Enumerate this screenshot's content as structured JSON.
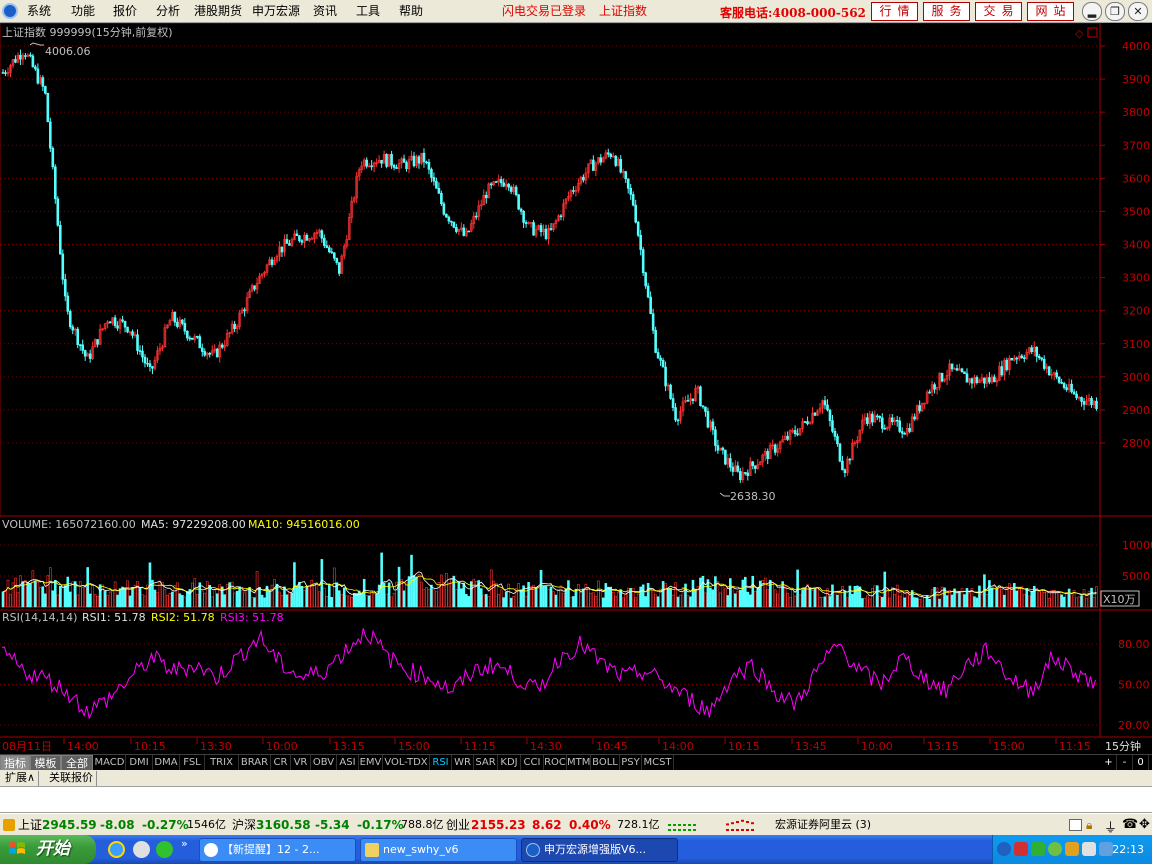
{
  "menubar": {
    "items": [
      "系统",
      "功能",
      "报价",
      "分析",
      "港股期货",
      "申万宏源",
      "资讯",
      "工具",
      "帮助"
    ],
    "flash_login": "闪电交易已登录",
    "current_index": "上证指数",
    "hotline": "客服电话:4008-000-562",
    "quick_buttons": [
      "行情",
      "服务",
      "交易",
      "网站"
    ]
  },
  "price_pane": {
    "title": "上证指数 999999(15分钟,前复权)",
    "high_label": "4006.06",
    "low_label": "2638.30",
    "y_ticks": [
      "4000",
      "3900",
      "3800",
      "3700",
      "3600",
      "3500",
      "3400",
      "3300",
      "3200",
      "3100",
      "3000",
      "2900",
      "2800"
    ]
  },
  "volume_pane": {
    "label": "VOLUME: 165072160.00",
    "ma5": "MA5: 97229208.00",
    "ma10": "MA10: 94516016.00",
    "y_ticks": [
      "10000",
      "5000"
    ],
    "unit": "X10万"
  },
  "rsi_pane": {
    "label": "RSI(14,14,14)",
    "rsi1": "RSI1: 51.78",
    "rsi2": "RSI2: 51.78",
    "rsi3": "RSI3: 51.78",
    "y_ticks": [
      "80.00",
      "50.00",
      "20.00"
    ]
  },
  "time_axis": {
    "labels": [
      "08月11日",
      "14:00",
      "10:15",
      "13:30",
      "10:00",
      "13:15",
      "15:00",
      "11:15",
      "14:30",
      "10:45",
      "14:00",
      "10:15",
      "13:45",
      "10:00",
      "13:15",
      "15:00",
      "11:15"
    ],
    "period": "15分钟"
  },
  "indicator_tabs": {
    "categories": [
      "指标",
      "模板",
      "全部"
    ],
    "items": [
      "MACD",
      "DMI",
      "DMA",
      "FSL",
      "TRIX",
      "BRAR",
      "CR",
      "VR",
      "OBV",
      "ASI",
      "EMV",
      "VOL-TDX",
      "RSI",
      "WR",
      "SAR",
      "KDJ",
      "CCI",
      "ROC",
      "MTM",
      "BOLL",
      "PSY",
      "MCST"
    ],
    "active": "RSI",
    "controls": [
      "+",
      "-",
      "0"
    ]
  },
  "ext_tabs": [
    "扩展∧",
    "关联报价"
  ],
  "ticker": {
    "sh_name": "上证",
    "sh_price": "2945.59",
    "sh_change": "-8.08",
    "sh_pct": "-0.27%",
    "sh_amount": "1546亿",
    "hs_name": "沪深",
    "hs_price": "3160.58",
    "hs_change": "-5.34",
    "hs_pct": "-0.17%",
    "hs_amount": "788.8亿",
    "cy_name": "创业",
    "cy_price": "2155.23",
    "cy_change": "8.62",
    "cy_pct": "0.40%",
    "cy_amount": "728.1亿",
    "broker": "宏源证券阿里云 (3)"
  },
  "taskbar": {
    "start_label": "开始",
    "tasks": [
      "【新提醒】12 - 2...",
      "new_swhy_v6",
      "申万宏源增强版V6..."
    ],
    "clock": "22:13"
  },
  "chart_data": [
    {
      "type": "line",
      "title": "上证指数 999999(15分钟,前复权)",
      "description": "candlestick (OHLC) price series, 15-minute bars",
      "ylim": [
        2600,
        4050
      ],
      "annotations": [
        {
          "label": "4006.06",
          "kind": "high"
        },
        {
          "label": "2638.30",
          "kind": "low"
        }
      ],
      "x": [
        0,
        25,
        50,
        75,
        100,
        125,
        150,
        175,
        200,
        225,
        250,
        275,
        300,
        325,
        350,
        375,
        400,
        425,
        450,
        475,
        500,
        525,
        550,
        575,
        600,
        625,
        650,
        675,
        700,
        725,
        750,
        775,
        800,
        825,
        850,
        875,
        900,
        925,
        950,
        975,
        1000,
        1025,
        1050,
        1075,
        1100
      ],
      "values": [
        3920,
        3990,
        3860,
        3200,
        3050,
        3180,
        3150,
        3010,
        3180,
        3120,
        3060,
        3150,
        3280,
        3380,
        3420,
        3440,
        3320,
        3650,
        3660,
        3640,
        3660,
        3500,
        3420,
        3560,
        3600,
        3450,
        3430,
        3560,
        3640,
        3680,
        3520,
        3100,
        2880,
        2960,
        2780,
        2700,
        2750,
        2800,
        2850,
        2930,
        2720,
        2880,
        2860,
        2840,
        2960,
        3020,
        2990,
        2990,
        3060,
        3080,
        3000,
        2940,
        2920
      ],
      "series_note": "approximate close levels read off the price axis"
    },
    {
      "type": "bar",
      "title": "VOLUME",
      "unit": "X10万",
      "ylim": [
        0,
        12000
      ],
      "values": [
        3800,
        4200,
        3600,
        3200,
        3000,
        3400,
        3100,
        2900,
        3300,
        3000,
        2800,
        3200,
        3500,
        3100,
        2900,
        3400,
        3200,
        4200,
        4000,
        3300,
        3100,
        2800,
        2900,
        3100,
        3000,
        2800,
        2700,
        3000,
        3200,
        3600,
        3400,
        3800,
        3200,
        2800,
        2600,
        2700,
        2500,
        2600,
        2400,
        2500,
        2600,
        3800,
        3000,
        2700,
        2500,
        2400
      ]
    },
    {
      "type": "line",
      "title": "RSI(14,14,14)",
      "ylim": [
        10,
        100
      ],
      "series": [
        {
          "name": "RSI1",
          "values": [
            75,
            60,
            55,
            45,
            30,
            40,
            55,
            70,
            60,
            65,
            55,
            70,
            85,
            65,
            55,
            60,
            75,
            90,
            70,
            60,
            55,
            45,
            60,
            65,
            55,
            45,
            70,
            80,
            65,
            55,
            60,
            50,
            40,
            30,
            55,
            65,
            45,
            35,
            60,
            80,
            60,
            50,
            70,
            55,
            45,
            65,
            75,
            55,
            45,
            70,
            60,
            50
          ]
        }
      ]
    }
  ]
}
